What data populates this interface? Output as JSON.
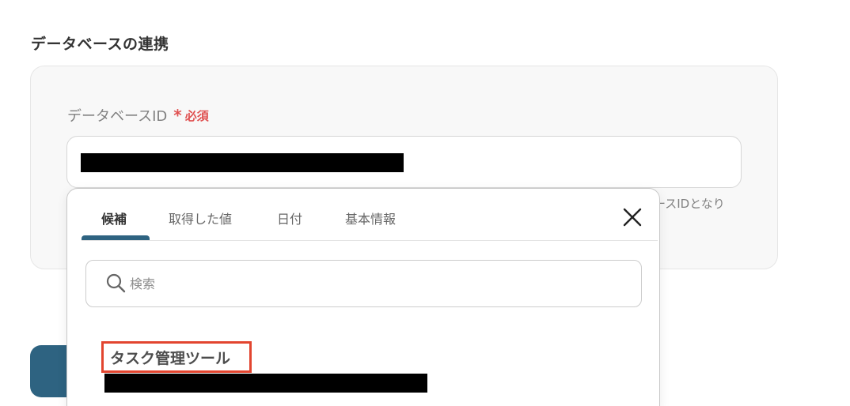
{
  "section": {
    "title": "データベースの連携"
  },
  "field": {
    "label": "データベースID",
    "required_mark": "*",
    "required_text": "必須",
    "helper_fragment": "ースIDとなり"
  },
  "dropdown": {
    "tabs": [
      {
        "label": "候補",
        "active": true
      },
      {
        "label": "取得した値",
        "active": false
      },
      {
        "label": "日付",
        "active": false
      },
      {
        "label": "基本情報",
        "active": false
      }
    ],
    "search": {
      "placeholder": "検索",
      "value": ""
    },
    "results": [
      {
        "label": "タスク管理ツール"
      }
    ]
  },
  "icons": {
    "close": "close-icon",
    "search": "search-icon"
  },
  "colors": {
    "accent": "#2e6381",
    "required": "#e05252",
    "highlight": "#e2452f"
  }
}
